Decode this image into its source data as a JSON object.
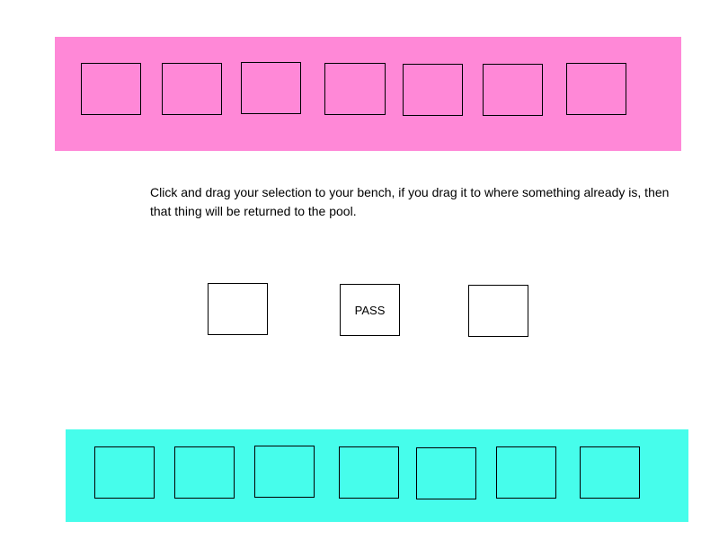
{
  "colors": {
    "pool_background": "#ff88d7",
    "bench_background": "#46fdeb",
    "slot_border": "#000000"
  },
  "pool": {
    "slot_count": 7
  },
  "instructions": {
    "text": "Click and drag your selection to your bench, if you drag it to where something already is, then that thing will be returned to the pool."
  },
  "choices": {
    "left_label": "",
    "pass_label": "PASS",
    "right_label": ""
  },
  "bench": {
    "slot_count": 7
  }
}
